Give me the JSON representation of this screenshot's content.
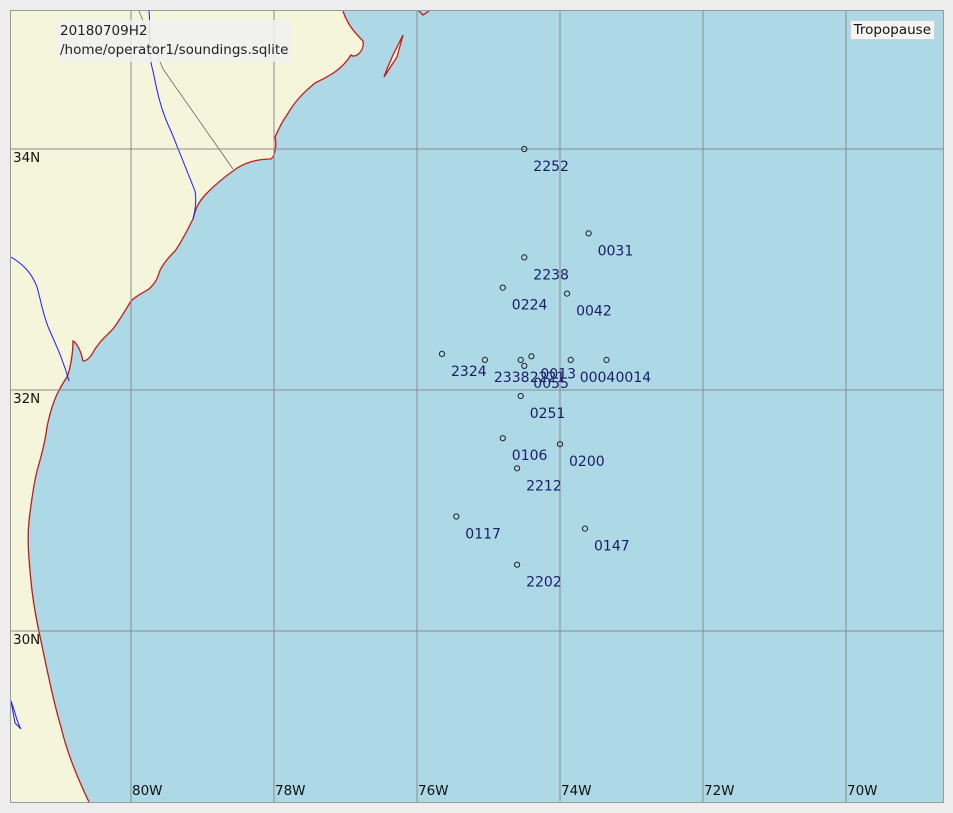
{
  "info": {
    "date_label": "20180709H2",
    "database_path": "/home/operator1/soundings.sqlite"
  },
  "layer_label": "Tropopause",
  "latitude_labels": [
    "34N",
    "32N",
    "30N"
  ],
  "longitude_labels": [
    "80W",
    "78W",
    "76W",
    "74W",
    "72W",
    "70W"
  ],
  "colors": {
    "ocean": "#add8e6",
    "land": "#f5f5dc",
    "coastline": "#c41a1a",
    "rivers": "#1a1aff",
    "gridlines": "#8c8c8c",
    "station_text": "#1c1c66"
  },
  "stations": [
    {
      "name": "2252",
      "lat": 34.0,
      "lon": -74.5
    },
    {
      "name": "0031",
      "lat": 33.3,
      "lon": -73.6
    },
    {
      "name": "2238",
      "lat": 33.1,
      "lon": -74.5
    },
    {
      "name": "0042",
      "lat": 32.8,
      "lon": -73.9
    },
    {
      "name": "0224",
      "lat": 32.85,
      "lon": -74.8
    },
    {
      "name": "2324",
      "lat": 32.3,
      "lon": -75.65
    },
    {
      "name": "2338",
      "lat": 32.25,
      "lon": -75.05
    },
    {
      "name": "2221",
      "lat": 32.25,
      "lon": -74.55
    },
    {
      "name": "0013",
      "lat": 32.28,
      "lon": -74.4
    },
    {
      "name": "0055",
      "lat": 32.2,
      "lon": -74.5
    },
    {
      "name": "0004",
      "lat": 32.25,
      "lon": -73.85
    },
    {
      "name": "0014",
      "lat": 32.25,
      "lon": -73.35
    },
    {
      "name": "0251",
      "lat": 31.95,
      "lon": -74.55
    },
    {
      "name": "0106",
      "lat": 31.6,
      "lon": -74.8
    },
    {
      "name": "0200",
      "lat": 31.55,
      "lon": -74.0
    },
    {
      "name": "2212",
      "lat": 31.35,
      "lon": -74.6
    },
    {
      "name": "0117",
      "lat": 30.95,
      "lon": -75.45
    },
    {
      "name": "0147",
      "lat": 30.85,
      "lon": -73.65
    },
    {
      "name": "2202",
      "lat": 30.55,
      "lon": -74.6
    }
  ]
}
